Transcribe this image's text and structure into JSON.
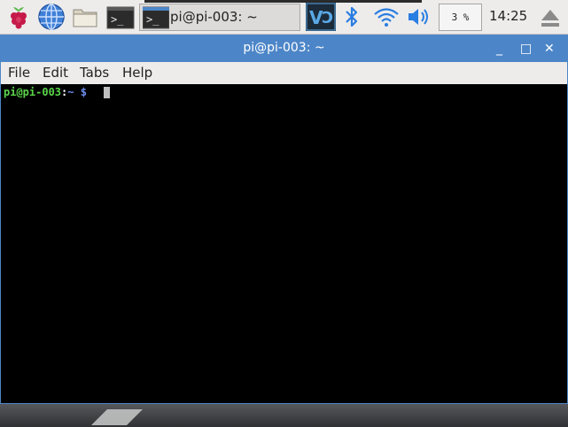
{
  "taskbar": {
    "launchers": [
      "raspberry-menu",
      "web-browser",
      "file-manager",
      "terminal"
    ],
    "task_label": "pi@pi-003: ~",
    "cpu_usage": "3 %",
    "clock": "14:25"
  },
  "window": {
    "title": "pi@pi-003: ~",
    "menu": {
      "file": "File",
      "edit": "Edit",
      "tabs": "Tabs",
      "help": "Help"
    },
    "controls": {
      "minimize": "_",
      "maximize": "□",
      "close": "✕"
    }
  },
  "terminal": {
    "user_host": "pi@pi-003",
    "colon": ":",
    "path": "~",
    "dollar": " $"
  },
  "colors": {
    "titlebar": "#4d86c8",
    "prompt_user": "#5ad44a",
    "prompt_path": "#6c8ef0"
  }
}
